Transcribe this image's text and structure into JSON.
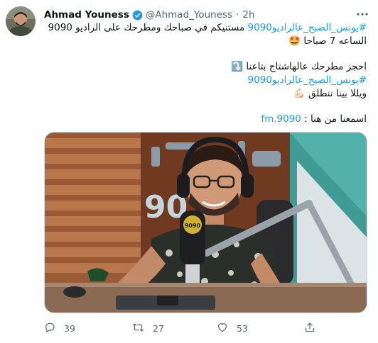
{
  "author": {
    "name": "Ahmad Youness",
    "handle": "@Ahmad_Youness",
    "separator": "·",
    "time": "2h"
  },
  "tweet": {
    "line1_tag": "#يونس_الصبح_عالراديو9090",
    "line1_text": " مستنيكم في صباحك ومطرحك على الراديو 9090",
    "line2": "الساعه 7 صباحا 🤩",
    "line3": "احجز مطرحك عالهاشتاج بتاعنا ⤵️",
    "line4_tag": "#يونس_الصبح_عالراديو9090",
    "line5": "ويللا بينا ننطلق 💪🏻",
    "line6_text": "اسمعنا من هنا : ",
    "line6_link": "9090.fm"
  },
  "media": {
    "logo_text": "90",
    "mic_badge": "9090"
  },
  "actions": {
    "replies": "39",
    "retweets": "27",
    "likes": "53"
  },
  "colors": {
    "accent": "#1d9bf0",
    "muted": "#536471",
    "text": "#0f1419"
  },
  "icons": [
    "more-icon",
    "verified-icon",
    "reply-icon",
    "retweet-icon",
    "like-icon",
    "share-icon"
  ]
}
